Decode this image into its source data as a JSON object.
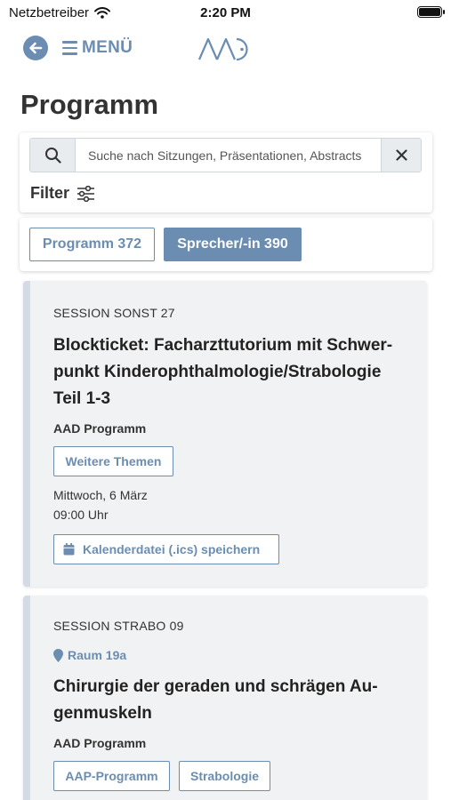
{
  "status_bar": {
    "carrier": "Netzbetreiber",
    "time": "2:20 PM"
  },
  "nav": {
    "menu_label": "MENÜ",
    "logo_text": "AAD"
  },
  "page": {
    "title": "Programm"
  },
  "search": {
    "placeholder": "Suche nach Sitzungen, Präsentationen, Abstracts",
    "value": ""
  },
  "filter": {
    "label": "Filter"
  },
  "tabs": [
    {
      "label": "Programm 372",
      "active": false
    },
    {
      "label": "Sprecher/-in 390",
      "active": true
    }
  ],
  "sessions": [
    {
      "code": "SESSION SONST 27",
      "title_lines": [
        "Blockticket: Facharzttutorium mit Schwer-",
        "punkt Kinderophthalmologie/Strabologie",
        "Teil 1-3"
      ],
      "org": "AAD Programm",
      "tags": [
        "Weitere Themen"
      ],
      "date": "Mittwoch, 6 März",
      "time": "09:00 Uhr",
      "ics_label": "Kalenderdatei (.ics) speichern"
    },
    {
      "code": "SESSION STRABO 09",
      "room": "Raum 19a",
      "title_lines": [
        "Chirurgie der geraden und schrägen Au-",
        "genmuskeln"
      ],
      "org": "AAD Programm",
      "tags": [
        "AAP-Programm",
        "Strabologie"
      ]
    }
  ],
  "colors": {
    "accent": "#6b8db2",
    "card_bg": "#f1f2f4",
    "card_border": "#d4dbe4"
  }
}
